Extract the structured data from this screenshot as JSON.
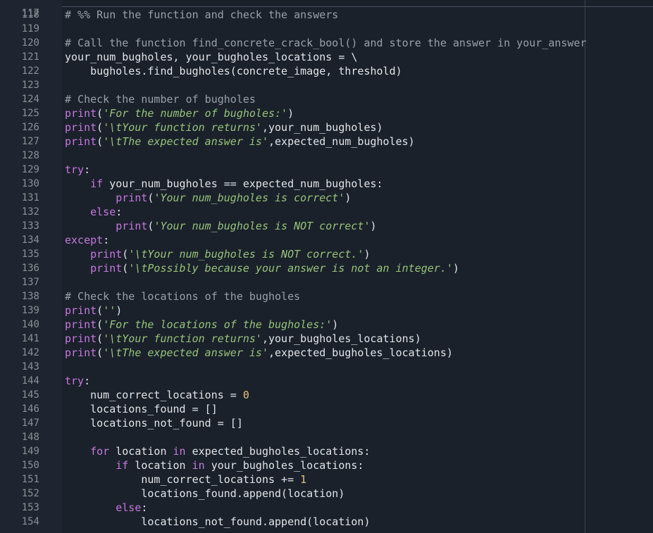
{
  "editor": {
    "colors": {
      "background": "#1e2530",
      "code_background": "#1a212b",
      "line_number": "#8a9099",
      "comment": "#9aa0a8",
      "keyword": "#c678dd",
      "string": "#98c379",
      "number": "#e5c07b",
      "text": "#e2e4e8"
    },
    "first_line_fragment": "117",
    "lines": [
      {
        "num": "118",
        "tokens": [
          {
            "t": "cm",
            "v": "# %% Run the function and check the answers"
          }
        ]
      },
      {
        "num": "119",
        "tokens": []
      },
      {
        "num": "120",
        "tokens": [
          {
            "t": "cm",
            "v": "# Call the function find_concrete_crack_bool() and store the answer in your_answer"
          }
        ]
      },
      {
        "num": "121",
        "tokens": [
          {
            "t": "tx",
            "v": "your_num_bugholes, your_bugholes_locations = \\"
          }
        ]
      },
      {
        "num": "122",
        "tokens": [
          {
            "t": "tx",
            "v": "    bugholes.find_bugholes(concrete_image, threshold)"
          }
        ]
      },
      {
        "num": "123",
        "tokens": []
      },
      {
        "num": "124",
        "tokens": [
          {
            "t": "cm",
            "v": "# Check the number of bugholes"
          }
        ]
      },
      {
        "num": "125",
        "tokens": [
          {
            "t": "kw",
            "v": "print"
          },
          {
            "t": "tx",
            "v": "("
          },
          {
            "t": "st",
            "v": "'For the number of bugholes:'"
          },
          {
            "t": "tx",
            "v": ")"
          }
        ]
      },
      {
        "num": "126",
        "tokens": [
          {
            "t": "kw",
            "v": "print"
          },
          {
            "t": "tx",
            "v": "("
          },
          {
            "t": "st",
            "v": "'\\tYour function returns'"
          },
          {
            "t": "tx",
            "v": ",your_num_bugholes)"
          }
        ]
      },
      {
        "num": "127",
        "tokens": [
          {
            "t": "kw",
            "v": "print"
          },
          {
            "t": "tx",
            "v": "("
          },
          {
            "t": "st",
            "v": "'\\tThe expected answer is'"
          },
          {
            "t": "tx",
            "v": ",expected_num_bugholes)"
          }
        ]
      },
      {
        "num": "128",
        "tokens": []
      },
      {
        "num": "129",
        "tokens": [
          {
            "t": "kw",
            "v": "try"
          },
          {
            "t": "tx",
            "v": ":"
          }
        ]
      },
      {
        "num": "130",
        "tokens": [
          {
            "t": "tx",
            "v": "    "
          },
          {
            "t": "kw",
            "v": "if"
          },
          {
            "t": "tx",
            "v": " your_num_bugholes == expected_num_bugholes:"
          }
        ]
      },
      {
        "num": "131",
        "tokens": [
          {
            "t": "tx",
            "v": "        "
          },
          {
            "t": "kw",
            "v": "print"
          },
          {
            "t": "tx",
            "v": "("
          },
          {
            "t": "st",
            "v": "'Your num_bugholes is correct'"
          },
          {
            "t": "tx",
            "v": ")"
          }
        ]
      },
      {
        "num": "132",
        "tokens": [
          {
            "t": "tx",
            "v": "    "
          },
          {
            "t": "kw",
            "v": "else"
          },
          {
            "t": "tx",
            "v": ":"
          }
        ]
      },
      {
        "num": "133",
        "tokens": [
          {
            "t": "tx",
            "v": "        "
          },
          {
            "t": "kw",
            "v": "print"
          },
          {
            "t": "tx",
            "v": "("
          },
          {
            "t": "st",
            "v": "'Your num_bugholes is NOT correct'"
          },
          {
            "t": "tx",
            "v": ")"
          }
        ]
      },
      {
        "num": "134",
        "tokens": [
          {
            "t": "kw",
            "v": "except"
          },
          {
            "t": "tx",
            "v": ":"
          }
        ]
      },
      {
        "num": "135",
        "tokens": [
          {
            "t": "tx",
            "v": "    "
          },
          {
            "t": "kw",
            "v": "print"
          },
          {
            "t": "tx",
            "v": "("
          },
          {
            "t": "st",
            "v": "'\\tYour num_bugholes is NOT correct.'"
          },
          {
            "t": "tx",
            "v": ")"
          }
        ]
      },
      {
        "num": "136",
        "tokens": [
          {
            "t": "tx",
            "v": "    "
          },
          {
            "t": "kw",
            "v": "print"
          },
          {
            "t": "tx",
            "v": "("
          },
          {
            "t": "st",
            "v": "'\\tPossibly because your answer is not an integer.'"
          },
          {
            "t": "tx",
            "v": ")"
          }
        ]
      },
      {
        "num": "137",
        "tokens": []
      },
      {
        "num": "138",
        "tokens": [
          {
            "t": "cm",
            "v": "# Check the locations of the bugholes"
          }
        ]
      },
      {
        "num": "139",
        "tokens": [
          {
            "t": "kw",
            "v": "print"
          },
          {
            "t": "tx",
            "v": "("
          },
          {
            "t": "st",
            "v": "''"
          },
          {
            "t": "tx",
            "v": ")"
          }
        ]
      },
      {
        "num": "140",
        "tokens": [
          {
            "t": "kw",
            "v": "print"
          },
          {
            "t": "tx",
            "v": "("
          },
          {
            "t": "st",
            "v": "'For the locations of the bugholes:'"
          },
          {
            "t": "tx",
            "v": ")"
          }
        ]
      },
      {
        "num": "141",
        "tokens": [
          {
            "t": "kw",
            "v": "print"
          },
          {
            "t": "tx",
            "v": "("
          },
          {
            "t": "st",
            "v": "'\\tYour function returns'"
          },
          {
            "t": "tx",
            "v": ",your_bugholes_locations)"
          }
        ]
      },
      {
        "num": "142",
        "tokens": [
          {
            "t": "kw",
            "v": "print"
          },
          {
            "t": "tx",
            "v": "("
          },
          {
            "t": "st",
            "v": "'\\tThe expected answer is'"
          },
          {
            "t": "tx",
            "v": ",expected_bugholes_locations)"
          }
        ]
      },
      {
        "num": "143",
        "tokens": []
      },
      {
        "num": "144",
        "tokens": [
          {
            "t": "kw",
            "v": "try"
          },
          {
            "t": "tx",
            "v": ":"
          }
        ]
      },
      {
        "num": "145",
        "tokens": [
          {
            "t": "tx",
            "v": "    num_correct_locations = "
          },
          {
            "t": "nu",
            "v": "0"
          }
        ]
      },
      {
        "num": "146",
        "tokens": [
          {
            "t": "tx",
            "v": "    locations_found = []"
          }
        ]
      },
      {
        "num": "147",
        "tokens": [
          {
            "t": "tx",
            "v": "    locations_not_found = []"
          }
        ]
      },
      {
        "num": "148",
        "tokens": []
      },
      {
        "num": "149",
        "tokens": [
          {
            "t": "tx",
            "v": "    "
          },
          {
            "t": "kw",
            "v": "for"
          },
          {
            "t": "tx",
            "v": " location "
          },
          {
            "t": "kw",
            "v": "in"
          },
          {
            "t": "tx",
            "v": " expected_bugholes_locations:"
          }
        ]
      },
      {
        "num": "150",
        "tokens": [
          {
            "t": "tx",
            "v": "        "
          },
          {
            "t": "kw",
            "v": "if"
          },
          {
            "t": "tx",
            "v": " location "
          },
          {
            "t": "kw",
            "v": "in"
          },
          {
            "t": "tx",
            "v": " your_bugholes_locations:"
          }
        ]
      },
      {
        "num": "151",
        "tokens": [
          {
            "t": "tx",
            "v": "            num_correct_locations += "
          },
          {
            "t": "nu",
            "v": "1"
          }
        ]
      },
      {
        "num": "152",
        "tokens": [
          {
            "t": "tx",
            "v": "            locations_found.append(location)"
          }
        ]
      },
      {
        "num": "153",
        "tokens": [
          {
            "t": "tx",
            "v": "        "
          },
          {
            "t": "kw",
            "v": "else"
          },
          {
            "t": "tx",
            "v": ":"
          }
        ]
      },
      {
        "num": "154",
        "tokens": [
          {
            "t": "tx",
            "v": "            locations_not_found.append(location)"
          }
        ]
      }
    ]
  }
}
